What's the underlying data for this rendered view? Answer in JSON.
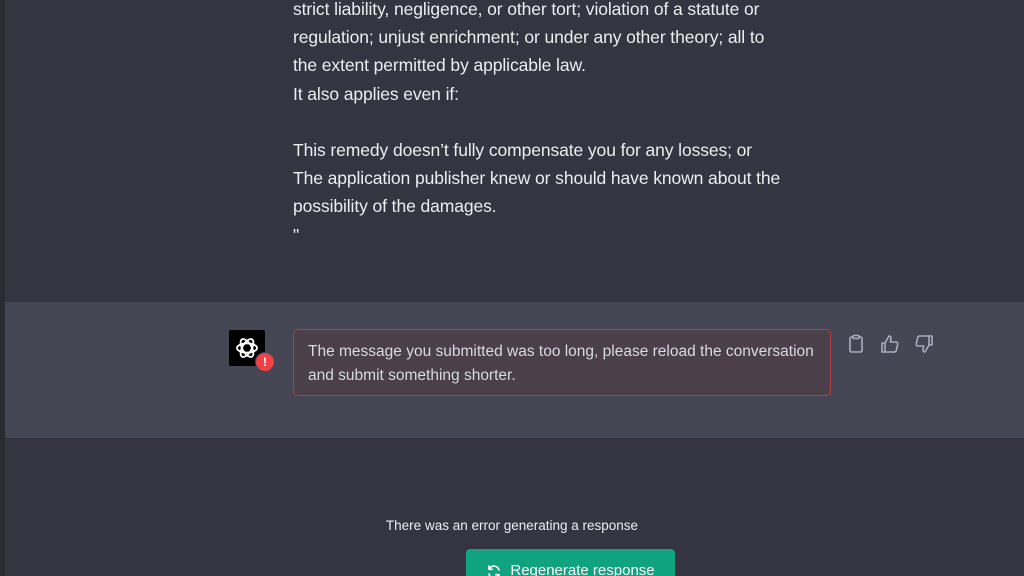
{
  "user_message": {
    "lines": [
      "strict liability, negligence, or other tort; violation of a statute or",
      "regulation; unjust enrichment; or under any other theory; all to",
      "the extent permitted by applicable law.",
      "It also applies even if:",
      "",
      "This remedy doesn’t fully compensate you for any losses; or",
      "The application publisher knew or should have known about the",
      "possibility of the damages.",
      "\""
    ]
  },
  "assistant": {
    "avatar_icon": "openai-logo-icon",
    "badge_icon": "error-badge-icon",
    "badge_text": "!",
    "error_message": "The message you submitted was too long, please reload the conversation and submit something shorter."
  },
  "actions": {
    "icons": [
      "clipboard-icon",
      "thumbs-up-icon",
      "thumbs-down-icon"
    ]
  },
  "footer": {
    "error_note": "There was an error generating a response",
    "regenerate_label": "Regenerate response",
    "regenerate_icon": "refresh-icon"
  },
  "colors": {
    "background": "#343541",
    "assistant_row": "#444654",
    "error_border": "#b93b45",
    "accent_green": "#10a37f",
    "badge_red": "#ef4146"
  }
}
